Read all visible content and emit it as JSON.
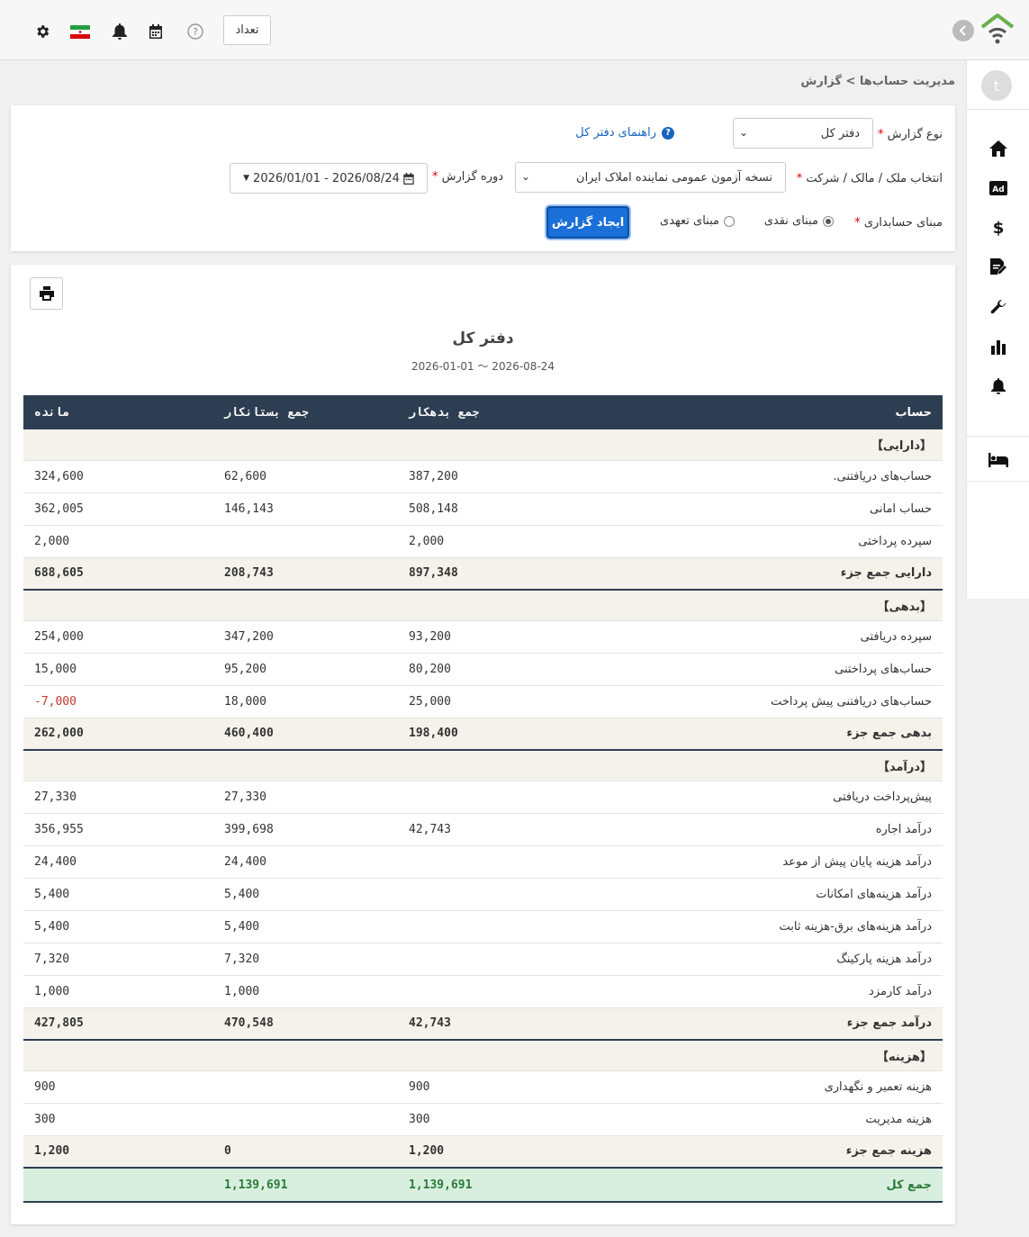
{
  "topbar": {
    "count_label": "تعداد",
    "icons": [
      "gear-icon",
      "iran-flag-icon",
      "bell-icon",
      "calendar-icon",
      "help-icon"
    ]
  },
  "sidebar": {
    "avatar_letter": "t",
    "icons": [
      "home-icon",
      "ad-icon",
      "dollar-icon",
      "edit-document-icon",
      "wrench-icon",
      "chart-icon",
      "bell-icon",
      "bed-icon"
    ]
  },
  "breadcrumb": "مدیریت حساب‌ها > گزارش",
  "form": {
    "report_type_label": "نوع گزارش",
    "report_type_value": "دفتر کل",
    "help_link": "راهنمای دفتر کل",
    "property_label": "انتخاب ملک / مالک / شرکت",
    "property_value": "نسخه آزمون عمومی نماینده املاک ایران",
    "period_label": "دوره گزارش",
    "period_value": "2026/01/01 - 2026/08/24",
    "basis_label": "مبنای حسابداری",
    "basis_cash": "مبنای نقدی",
    "basis_accrual": "مبنای تعهدی",
    "selected_basis": "cash",
    "generate_button": "ایجاد گزارش"
  },
  "report": {
    "title": "دفتر کل",
    "subtitle": "2026-01-01 〜 2026-08-24",
    "columns": {
      "account": "حساب",
      "debit": "جمع بدهکار",
      "credit": "جمع بستانکار",
      "balance": "مانده"
    },
    "sections": [
      {
        "name": "【دارایی】",
        "rows": [
          {
            "account": "حساب‌های دریافتنی.",
            "debit": "387,200",
            "credit": "62,600",
            "balance": "324,600"
          },
          {
            "account": "حساب امانی",
            "debit": "508,148",
            "credit": "146,143",
            "balance": "362,005"
          },
          {
            "account": "سپرده پرداختی",
            "debit": "2,000",
            "credit": "",
            "balance": "2,000"
          }
        ],
        "subtotal": {
          "label": "دارایی جمع جزء",
          "debit": "897,348",
          "credit": "208,743",
          "balance": "688,605"
        }
      },
      {
        "name": "【بدهی】",
        "rows": [
          {
            "account": "سپرده دریافتی",
            "debit": "93,200",
            "credit": "347,200",
            "balance": "254,000"
          },
          {
            "account": "حساب‌های پرداختنی",
            "debit": "80,200",
            "credit": "95,200",
            "balance": "15,000"
          },
          {
            "account": "حساب‌های دریافتنی پیش پرداخت",
            "debit": "25,000",
            "credit": "18,000",
            "balance": "7,000-",
            "negative": true
          }
        ],
        "subtotal": {
          "label": "بدهی جمع جزء",
          "debit": "198,400",
          "credit": "460,400",
          "balance": "262,000"
        }
      },
      {
        "name": "【درآمد】",
        "rows": [
          {
            "account": "پیش‌پرداخت دریافتی",
            "debit": "",
            "credit": "27,330",
            "balance": "27,330"
          },
          {
            "account": "درآمد اجاره",
            "debit": "42,743",
            "credit": "399,698",
            "balance": "356,955"
          },
          {
            "account": "درآمد هزینه پایان پیش از موعد",
            "debit": "",
            "credit": "24,400",
            "balance": "24,400"
          },
          {
            "account": "درآمد هزینه‌های امکانات",
            "debit": "",
            "credit": "5,400",
            "balance": "5,400"
          },
          {
            "account": "درآمد هزینه‌های برق-هزینه ثابت",
            "debit": "",
            "credit": "5,400",
            "balance": "5,400"
          },
          {
            "account": "درآمد هزینه پارکینگ",
            "debit": "",
            "credit": "7,320",
            "balance": "7,320"
          },
          {
            "account": "درآمد کارمزد",
            "debit": "",
            "credit": "1,000",
            "balance": "1,000"
          }
        ],
        "subtotal": {
          "label": "درآمد جمع جزء",
          "debit": "42,743",
          "credit": "470,548",
          "balance": "427,805"
        }
      },
      {
        "name": "【هزینه】",
        "rows": [
          {
            "account": "هزینه تعمیر و نگهداری",
            "debit": "900",
            "credit": "",
            "balance": "900"
          },
          {
            "account": "هزینه مدیریت",
            "debit": "300",
            "credit": "",
            "balance": "300"
          }
        ],
        "subtotal": {
          "label": "هزینه جمع جزء",
          "debit": "1,200",
          "credit": "0",
          "balance": "1,200"
        }
      }
    ],
    "grand_total": {
      "label": "جمع کل",
      "debit": "1,139,691",
      "credit": "1,139,691",
      "balance": ""
    }
  },
  "colors": {
    "header_bg": "#2e3e52",
    "section_bg": "#f4f2ea",
    "total_bg": "#d8efdf",
    "total_text": "#2b7a3a",
    "negative": "#c0392b",
    "primary": "#1a6fd8"
  }
}
